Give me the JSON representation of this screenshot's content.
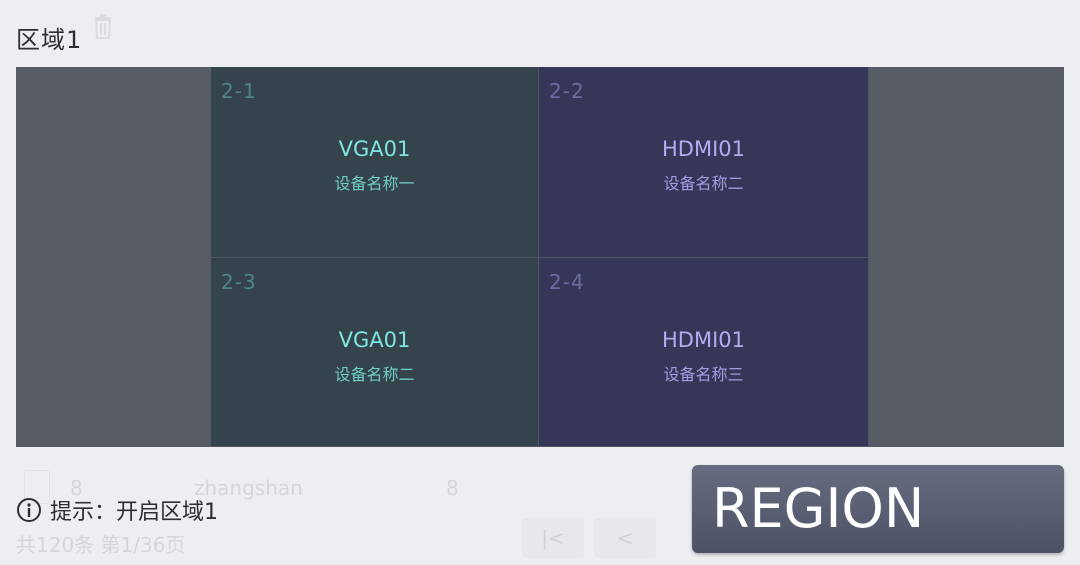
{
  "header": {
    "title": "区域1",
    "trash_icon": "trash-icon"
  },
  "cells": [
    {
      "num": "2-1",
      "source": "VGA01",
      "device": "设备名称一",
      "theme": "teal"
    },
    {
      "num": "2-2",
      "source": "HDMI01",
      "device": "设备名称二",
      "theme": "purple"
    },
    {
      "num": "2-3",
      "source": "VGA01",
      "device": "设备名称二",
      "theme": "teal"
    },
    {
      "num": "2-4",
      "source": "HDMI01",
      "device": "设备名称三",
      "theme": "purple"
    }
  ],
  "ghost": {
    "row_num": "8",
    "name": "zhangshan",
    "value": "8",
    "footer": "共120条  第1/36页",
    "first_btn": "|<",
    "prev_btn": "<"
  },
  "hint": {
    "icon": "info-icon",
    "text": "提示：开启区域1"
  },
  "region_button": {
    "label": "REGION"
  },
  "colors": {
    "stage": "#565b64",
    "teal_cell": "#35434c",
    "purple_cell": "#363758",
    "teal_text": "#7ee7df",
    "purple_text": "#b4abf2"
  }
}
